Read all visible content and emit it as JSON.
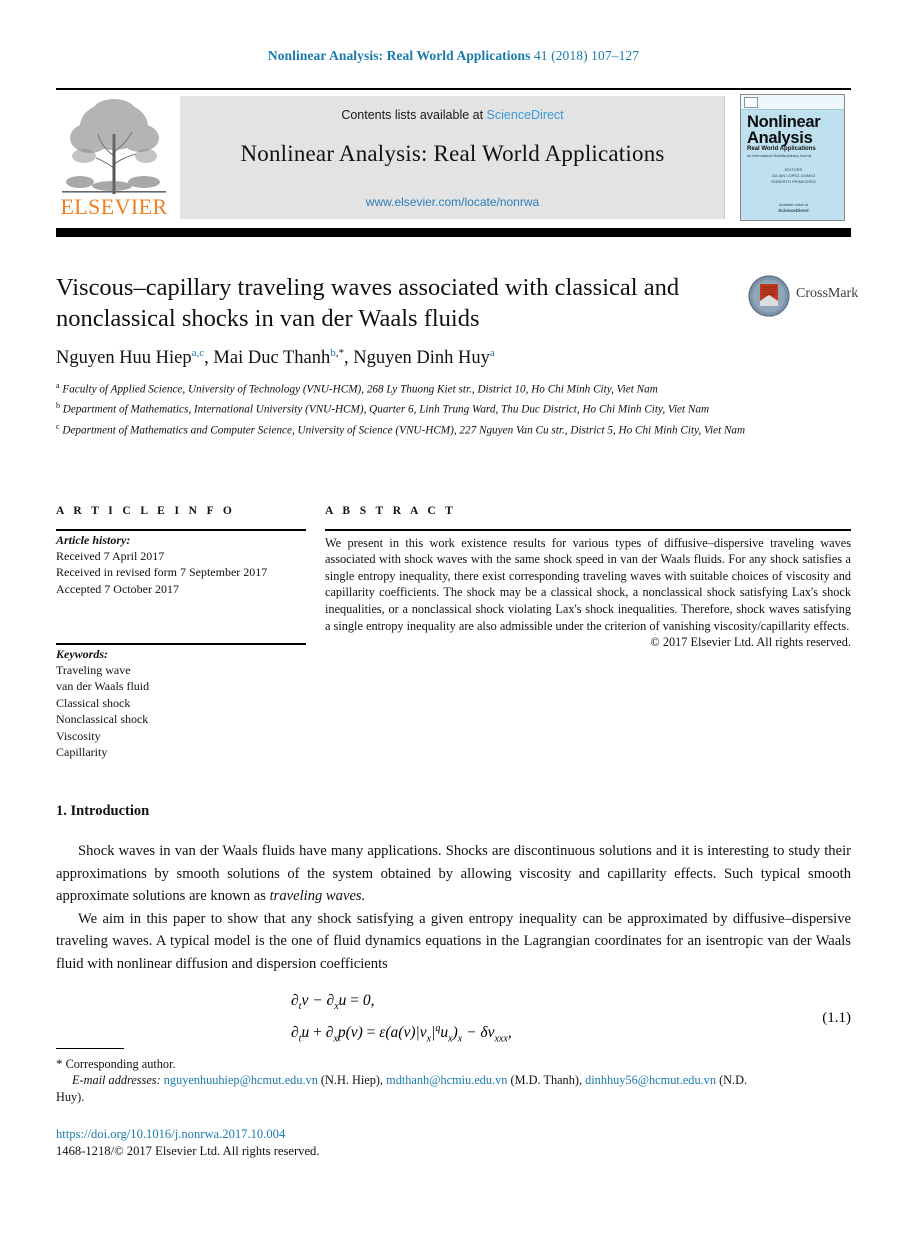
{
  "running_head": {
    "journal": "Nonlinear Analysis: Real World Applications",
    "volume_pages": "41 (2018) 107–127"
  },
  "masthead": {
    "contents_prefix": "Contents lists available at ",
    "sciencedirect": "ScienceDirect",
    "journal_title": "Nonlinear Analysis: Real World Applications",
    "journal_url": "www.elsevier.com/locate/nonrwa",
    "publisher_wordmark": "ELSEVIER",
    "cover": {
      "line1": "Nonlinear",
      "line2": "Analysis",
      "subtitle": "Real World Applications",
      "subtitle2": "An International Multidisciplinary Journal",
      "editors": "EDITORS\nJULIAN LOPEZ-GOMEZ\nROBERTO PRIMICERIO",
      "bottom_note": "Available online at",
      "bottom_brand": "ScienceDirect"
    }
  },
  "article": {
    "title": "Viscous–capillary traveling waves associated with classical and nonclassical shocks in van der Waals fluids",
    "authors_plain": "Nguyen Huu Hiep, Mai Duc Thanh, Nguyen Dinh Huy",
    "authors": [
      {
        "name": "Nguyen Huu Hiep",
        "marks": "a,c",
        "sep": ", "
      },
      {
        "name": "Mai Duc Thanh",
        "marks": "b",
        "star": true,
        "sep": ", "
      },
      {
        "name": "Nguyen Dinh Huy",
        "marks": "a",
        "sep": ""
      }
    ],
    "affiliations": [
      {
        "label": "a",
        "text": "Faculty of Applied Science, University of Technology (VNU-HCM), 268 Ly Thuong Kiet str., District 10, Ho Chi Minh City, Viet Nam"
      },
      {
        "label": "b",
        "text": "Department of Mathematics, International University (VNU-HCM), Quarter 6, Linh Trung Ward, Thu Duc District, Ho Chi Minh City, Viet Nam"
      },
      {
        "label": "c",
        "text": "Department of Mathematics and Computer Science, University of Science (VNU-HCM), 227 Nguyen Van Cu str., District 5, Ho Chi Minh City, Viet Nam"
      }
    ],
    "crossmark_label": "CrossMark"
  },
  "article_info": {
    "section_label": "A R T I C L E   I N F O",
    "history_title": "Article history:",
    "history": [
      "Received 7 April 2017",
      "Received in revised form 7 September 2017",
      "Accepted 7 October 2017"
    ],
    "keywords_title": "Keywords:",
    "keywords": [
      "Traveling wave",
      "van der Waals fluid",
      "Classical shock",
      "Nonclassical shock",
      "Viscosity",
      "Capillarity"
    ]
  },
  "abstract": {
    "section_label": "A B S T R A C T",
    "text": "We present in this work existence results for various types of diffusive–dispersive traveling waves associated with shock waves with the same shock speed in van der Waals fluids. For any shock satisfies a single entropy inequality, there exist corresponding traveling waves with suitable choices of viscosity and capillarity coefficients. The shock may be a classical shock, a nonclassical shock satisfying Lax's shock inequalities, or a nonclassical shock violating Lax's shock inequalities. Therefore, shock waves satisfying a single entropy inequality are also admissible under the criterion of vanishing viscosity/capillarity effects.",
    "copyright": "© 2017 Elsevier Ltd. All rights reserved."
  },
  "body": {
    "section_heading": "1.  Introduction",
    "paragraph1": "Shock waves in van der Waals fluids have many applications. Shocks are discontinuous solutions and it is interesting to study their approximations by smooth solutions of the system obtained by allowing viscosity and capillarity effects. Such typical smooth approximate solutions are known as ",
    "paragraph1_italic": "traveling waves.",
    "paragraph2": "We aim in this paper to show that any shock satisfying a given entropy inequality can be approximated by diffusive–dispersive traveling waves. A typical model is the one of fluid dynamics equations in the Lagrangian coordinates for an isentropic van der Waals fluid with nonlinear diffusion and dispersion coefficients"
  },
  "equation": {
    "line1_plain": "∂tv − ∂xu = 0,",
    "line2_plain": "∂tu + ∂xp(v) = ε(a(v)|vx|^q ux)x − δvxxx,",
    "number": "(1.1)"
  },
  "footnotes": {
    "corresponding_mark": "*",
    "corresponding_text": "Corresponding author.",
    "email_label": "E-mail addresses:",
    "emails": [
      {
        "address": "nguyenhuuhiep@hcmut.edu.vn",
        "owner": "(N.H. Hiep)",
        "sep": ", "
      },
      {
        "address": "mdthanh@hcmiu.edu.vn",
        "owner": "(M.D. Thanh)",
        "sep": ","
      },
      {
        "address": "dinhhuy56@hcmut.edu.vn",
        "owner": "(N.D. Huy).",
        "sep": ""
      }
    ],
    "doi": "https://doi.org/10.1016/j.nonrwa.2017.10.004",
    "issn_line": "1468-1218/© 2017 Elsevier Ltd. All rights reserved."
  },
  "colors": {
    "link_blue": "#1a7aad",
    "sciencedirect_blue": "#3a9ad9",
    "elsevier_orange": "#f07f20",
    "cover_blue": "#bfe0ef",
    "masthead_gray": "#e3e3e3"
  }
}
